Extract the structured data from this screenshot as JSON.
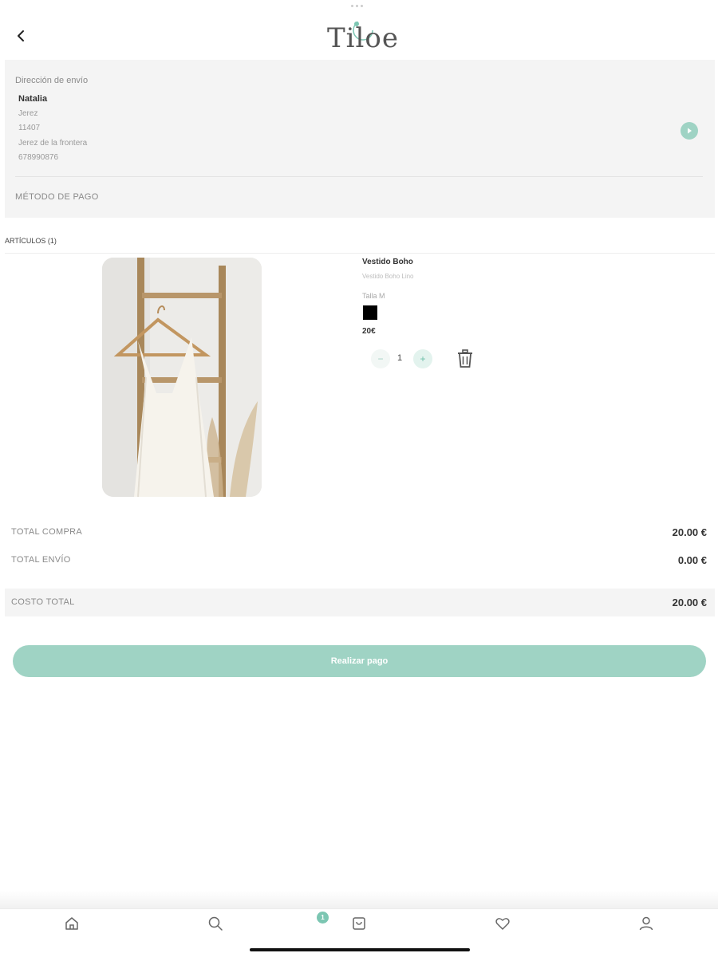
{
  "header": {
    "logo": "Tiloe"
  },
  "address": {
    "heading": "Dirección de envío",
    "name": "Natalia",
    "lines": [
      "Jerez",
      "11407",
      "Jerez de la frontera",
      "678990876"
    ]
  },
  "payment": {
    "label": "MÉTODO DE PAGO"
  },
  "articles": {
    "label": "ARTÍCULOS (1)",
    "items": [
      {
        "name": "Vestido Boho",
        "subtitle": "Vestido Boho Lino",
        "size": "Talla M",
        "color": "#000000",
        "price": "20€",
        "quantity": "1",
        "minus": "−",
        "plus": "+"
      }
    ]
  },
  "totals": {
    "purchase_label": "TOTAL COMPRA",
    "purchase_value": "20.00 €",
    "shipping_label": "TOTAL ENVÍO",
    "shipping_value": "0.00 €",
    "grand_label": "COSTO TOTAL",
    "grand_value": "20.00 €"
  },
  "pay_button": "Realizar pago",
  "tabbar": {
    "items": [
      "home-icon",
      "search-icon",
      "bag-icon",
      "heart-icon",
      "user-icon"
    ],
    "cart_badge": "1"
  },
  "colors": {
    "accent": "#9fd3c4",
    "card_bg": "#f4f4f4"
  }
}
